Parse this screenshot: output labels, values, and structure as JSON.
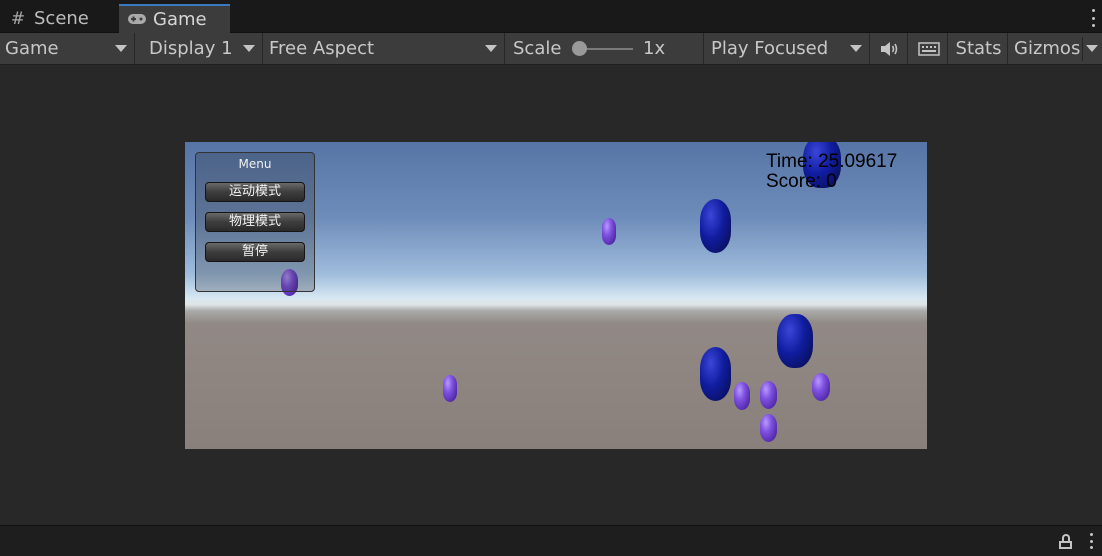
{
  "tabs": [
    {
      "label": "Scene",
      "icon": "grid-icon",
      "active": false
    },
    {
      "label": "Game",
      "icon": "gamepad-icon",
      "active": true
    }
  ],
  "toolbar": {
    "mode": "Game",
    "display": "Display 1",
    "aspect": "Free Aspect",
    "scale_label": "Scale",
    "scale_value": "1x",
    "scale_level": 0,
    "play_mode": "Play Focused",
    "stats": "Stats",
    "gizmos": "Gizmos"
  },
  "game": {
    "menu": {
      "title": "Menu",
      "buttons": [
        "运动模式",
        "物理模式",
        "暂停"
      ]
    },
    "hud": {
      "time": "Time: 25.09617",
      "score": "Score: 0"
    }
  },
  "colors": {
    "editor_bg": "#282828",
    "toolbar_bg": "#3c3c3c",
    "tab_accent": "#3a79bb",
    "capsule_purple": "#7f52e0",
    "capsule_blue": "#101c9e"
  }
}
